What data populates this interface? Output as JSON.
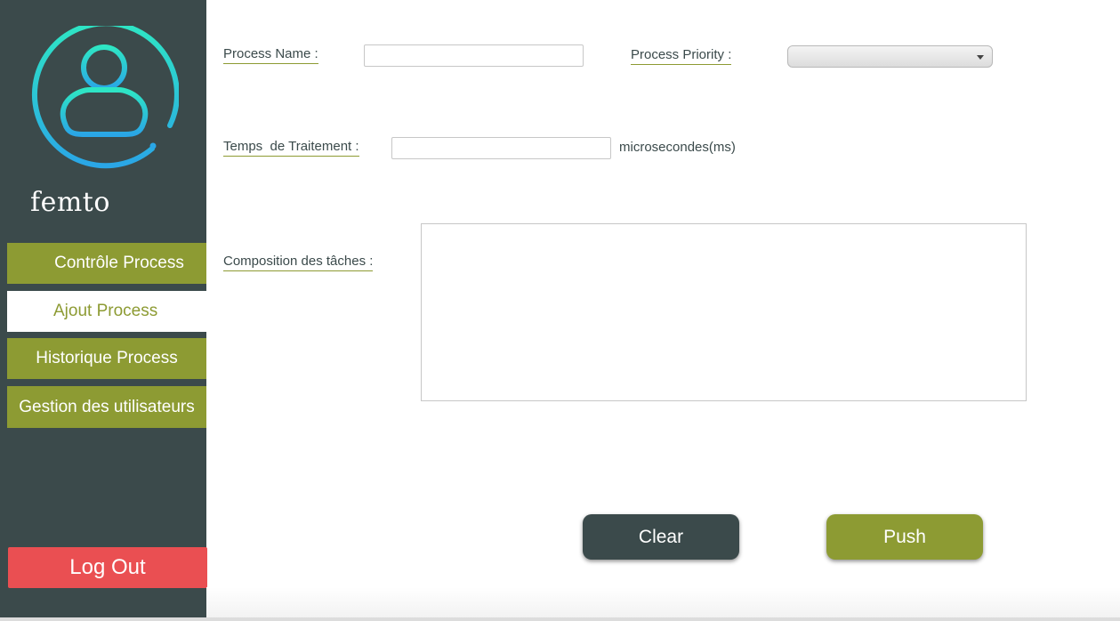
{
  "sidebar": {
    "app_name": "femto",
    "nav": [
      {
        "label": "Contrôle Process"
      },
      {
        "label": "Ajout Process"
      },
      {
        "label": "Historique Process"
      },
      {
        "label": "Gestion des utilisateurs"
      }
    ],
    "active_index": 1,
    "logout_label": "Log Out"
  },
  "form": {
    "process_name_label": "Process Name :",
    "process_name_value": "",
    "process_priority_label": "Process Priority :",
    "process_priority_value": "",
    "temps_label": "Temps  de Traitement :",
    "temps_value": "",
    "temps_unit": "microsecondes(ms)",
    "composition_label": "Composition des tâches :",
    "composition_value": ""
  },
  "actions": {
    "clear_label": "Clear",
    "push_label": "Push"
  },
  "colors": {
    "sidebar_bg": "#3b4a4b",
    "accent_olive": "#8d9b33",
    "logout_red": "#ea4f52",
    "avatar_gradient_start": "#2ee6c4",
    "avatar_gradient_end": "#2aa6e6"
  },
  "icons": {
    "avatar": "user-circle-icon",
    "select_caret": "caret-down-icon"
  }
}
